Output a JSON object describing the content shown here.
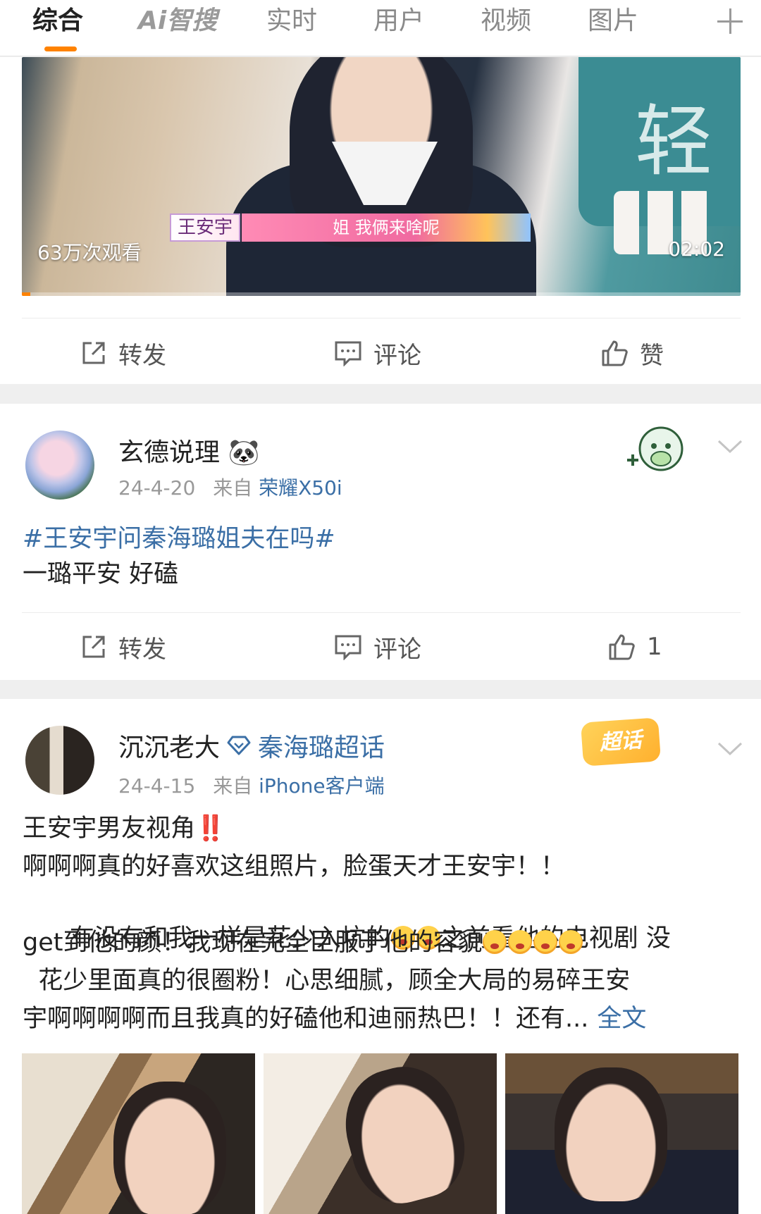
{
  "tabs": [
    {
      "label": "综合",
      "active": true
    },
    {
      "label": "Ai智搜"
    },
    {
      "label": "实时"
    },
    {
      "label": "用户"
    },
    {
      "label": "视频"
    },
    {
      "label": "图片"
    }
  ],
  "accent_color": "#ff8200",
  "link_color": "#3b6fa6",
  "video": {
    "views": "63万次观看",
    "duration": "02:02",
    "name_tag": "王安宇",
    "subtitle": "姐 我俩来啥呢",
    "sign_char": "轻",
    "progress_fraction": 0.012
  },
  "actions": {
    "repost": "转发",
    "comment": "评论",
    "like": "赞"
  },
  "post1": {
    "username": "玄德说理",
    "user_emoji": "🐼",
    "date": "24-4-20",
    "from_label": "来自",
    "source": "荣耀X50i",
    "hashtag": "#王安宇问秦海璐姐夫在吗#",
    "text": "一璐平安 好磕",
    "actions": {
      "repost": "转发",
      "comment": "评论",
      "like": "1"
    }
  },
  "post2": {
    "username": "沉沉老大",
    "supertopic": "秦海璐超话",
    "badge": "超话",
    "date": "24-4-15",
    "from_label": "来自",
    "source": "iPhone客户端",
    "line1": "王安宇男友视角",
    "line1_mark": "‼️",
    "line2": "啊啊啊真的好喜欢这组照片，脸蛋天才王安宇！！",
    "line3a": "  有没有和我一样是花少入坑的",
    "line3b": "之前看他的电视剧 没",
    "line4a": "get到他的颜！我现在完全臣服于他的容貌",
    "line5": "  花少里面真的很圈粉！心思细腻，顾全大局的易碎王安",
    "line6": "宇啊啊啊啊而且我真的好磕他和迪丽热巴！！还有...",
    "more": "全文"
  }
}
